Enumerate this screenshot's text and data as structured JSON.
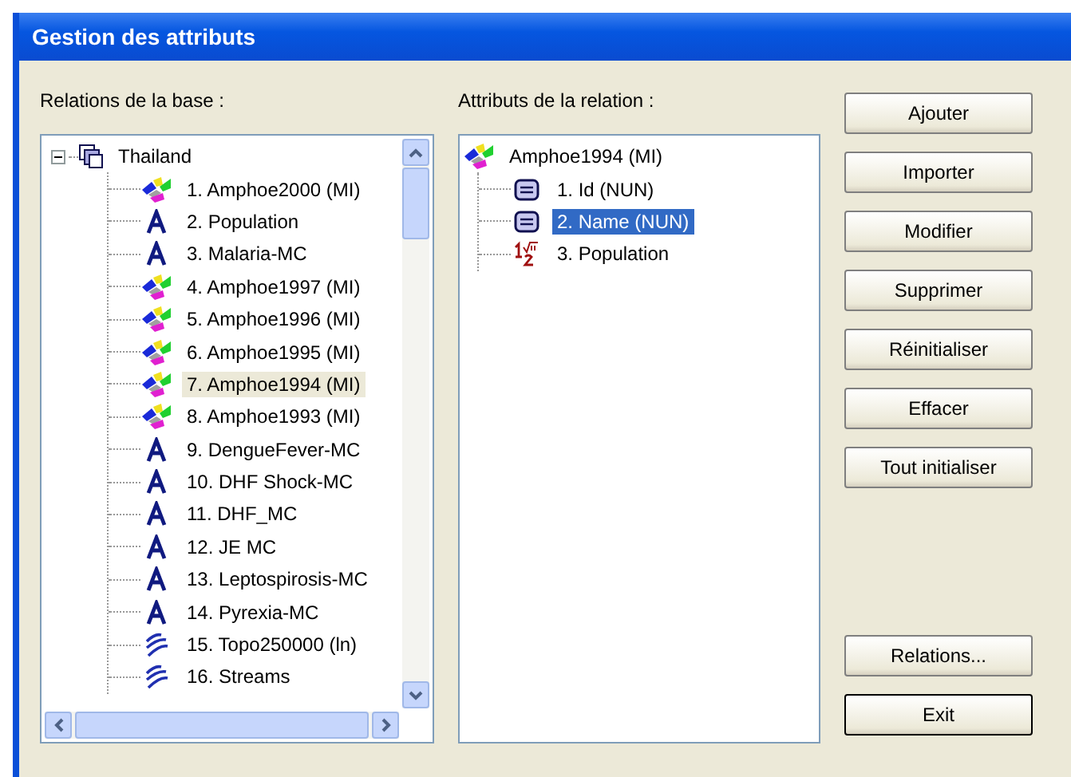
{
  "window": {
    "title": "Gestion des attributs"
  },
  "relations": {
    "label": "Relations de la base :",
    "root": {
      "name": "Thailand",
      "expanded": true,
      "children": [
        {
          "name": "1. Amphoe2000 (MI)",
          "kind": "map",
          "selected": false
        },
        {
          "name": "2. Population",
          "kind": "text",
          "selected": false
        },
        {
          "name": "3. Malaria-MC",
          "kind": "text",
          "selected": false
        },
        {
          "name": "4. Amphoe1997 (MI)",
          "kind": "map",
          "selected": false
        },
        {
          "name": "5. Amphoe1996 (MI)",
          "kind": "map",
          "selected": false
        },
        {
          "name": "6. Amphoe1995 (MI)",
          "kind": "map",
          "selected": false
        },
        {
          "name": "7. Amphoe1994 (MI)",
          "kind": "map",
          "selected": true
        },
        {
          "name": "8. Amphoe1993 (MI)",
          "kind": "map",
          "selected": false
        },
        {
          "name": "9. DengueFever-MC",
          "kind": "text",
          "selected": false
        },
        {
          "name": "10. DHF Shock-MC",
          "kind": "text",
          "selected": false
        },
        {
          "name": "11. DHF_MC",
          "kind": "text",
          "selected": false
        },
        {
          "name": "12. JE MC",
          "kind": "text",
          "selected": false
        },
        {
          "name": "13. Leptospirosis-MC",
          "kind": "text",
          "selected": false
        },
        {
          "name": "14. Pyrexia-MC",
          "kind": "text",
          "selected": false
        },
        {
          "name": "15. Topo250000 (ln)",
          "kind": "lines",
          "selected": false
        },
        {
          "name": "16. Streams",
          "kind": "lines",
          "selected": false
        }
      ]
    }
  },
  "attributes": {
    "label": "Attributs de la relation :",
    "root": {
      "name": "Amphoe1994 (MI)",
      "kind": "map",
      "children": [
        {
          "name": "1. Id (NUN)",
          "kind": "field",
          "selected": false
        },
        {
          "name": "2. Name (NUN)",
          "kind": "field",
          "selected": true
        },
        {
          "name": "3. Population",
          "kind": "number",
          "selected": false
        }
      ]
    }
  },
  "buttons": {
    "top": [
      "Ajouter",
      "Importer",
      "Modifier",
      "Supprimer",
      "Réinitialiser",
      "Effacer",
      "Tout initialiser"
    ],
    "bottom": [
      "Relations...",
      "Exit"
    ]
  }
}
